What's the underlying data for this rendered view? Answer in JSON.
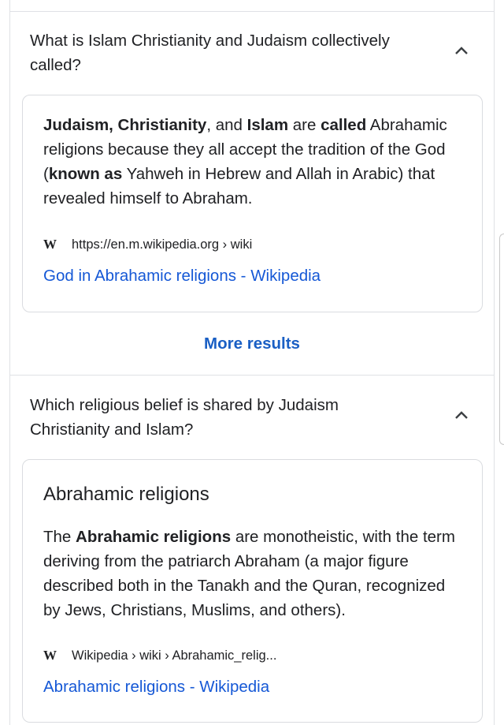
{
  "faq": [
    {
      "question": "What is Islam Christianity and Judaism collectively called?",
      "answer_parts": [
        {
          "t": "Judaism, Christianity",
          "b": true
        },
        {
          "t": ", and ",
          "b": false
        },
        {
          "t": "Islam",
          "b": true
        },
        {
          "t": " are ",
          "b": false
        },
        {
          "t": "called",
          "b": true
        },
        {
          "t": " Abrahamic religions because they all accept the tradition of the God (",
          "b": false
        },
        {
          "t": "known as",
          "b": true
        },
        {
          "t": " Yahweh in Hebrew and Allah in Arabic) that revealed himself to Abraham.",
          "b": false
        }
      ],
      "source_icon": "wikipedia-w-icon",
      "source_label": "W",
      "source_url": "https://en.m.wikipedia.org › wiki",
      "link": "God in Abrahamic religions - Wikipedia"
    },
    {
      "question": "Which religious belief is shared by Judaism Christianity and Islam?",
      "card_title": "Abrahamic religions",
      "answer_parts": [
        {
          "t": "The ",
          "b": false
        },
        {
          "t": "Abrahamic religions",
          "b": true
        },
        {
          "t": " are monotheistic, with the term deriving from the patriarch Abraham (a major figure described both in the Tanakh and the Quran, recognized by Jews, Christians, Muslims, and others).",
          "b": false
        }
      ],
      "source_icon": "wikipedia-w-icon",
      "source_label": "W",
      "source_url": "Wikipedia › wiki › Abrahamic_relig...",
      "link": "Abrahamic religions - Wikipedia"
    }
  ],
  "more_results": "More results",
  "colors": {
    "link": "#1558d6",
    "text": "#202124",
    "border": "#dadce0"
  }
}
